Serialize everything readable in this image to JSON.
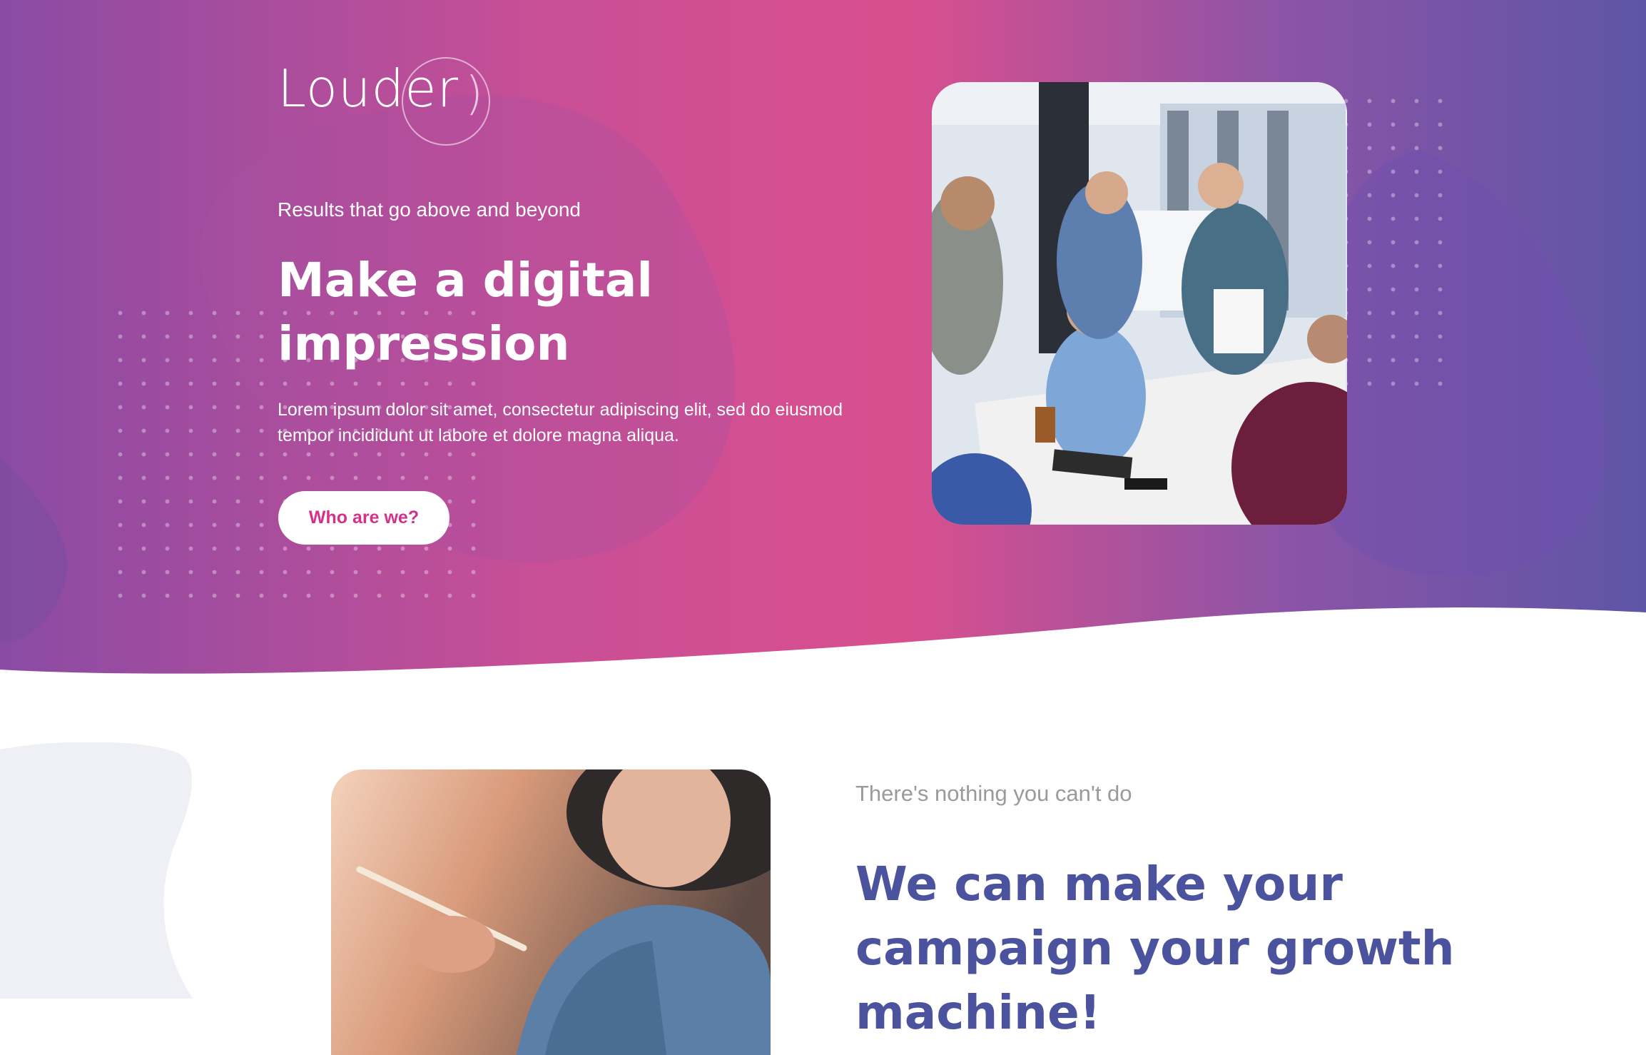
{
  "brand": {
    "name": "Louder",
    "mark": ")"
  },
  "hero": {
    "tagline": "Results that go above and beyond",
    "headline": "Make a digital impression",
    "body": "Lorem ipsum dolor sit amet, consectetur adipiscing elit, sed do eiusmod tempor incididunt ut labore et dolore magna aliqua.",
    "cta_label": "Who are we?",
    "image_description": "Team of coworkers celebrating and shaking hands around an office table"
  },
  "section": {
    "kicker": "There's nothing you can't do",
    "title": "We can make your campaign your growth machine!",
    "image_description": "Woman holding a pencil and working at a desk"
  },
  "colors": {
    "gradient_start": "#8a4ba4",
    "gradient_mid": "#d94f8e",
    "gradient_end": "#5e55a6",
    "accent": "#d4318c",
    "heading_blue": "#4b539e",
    "muted_text": "#9a9a9a"
  }
}
